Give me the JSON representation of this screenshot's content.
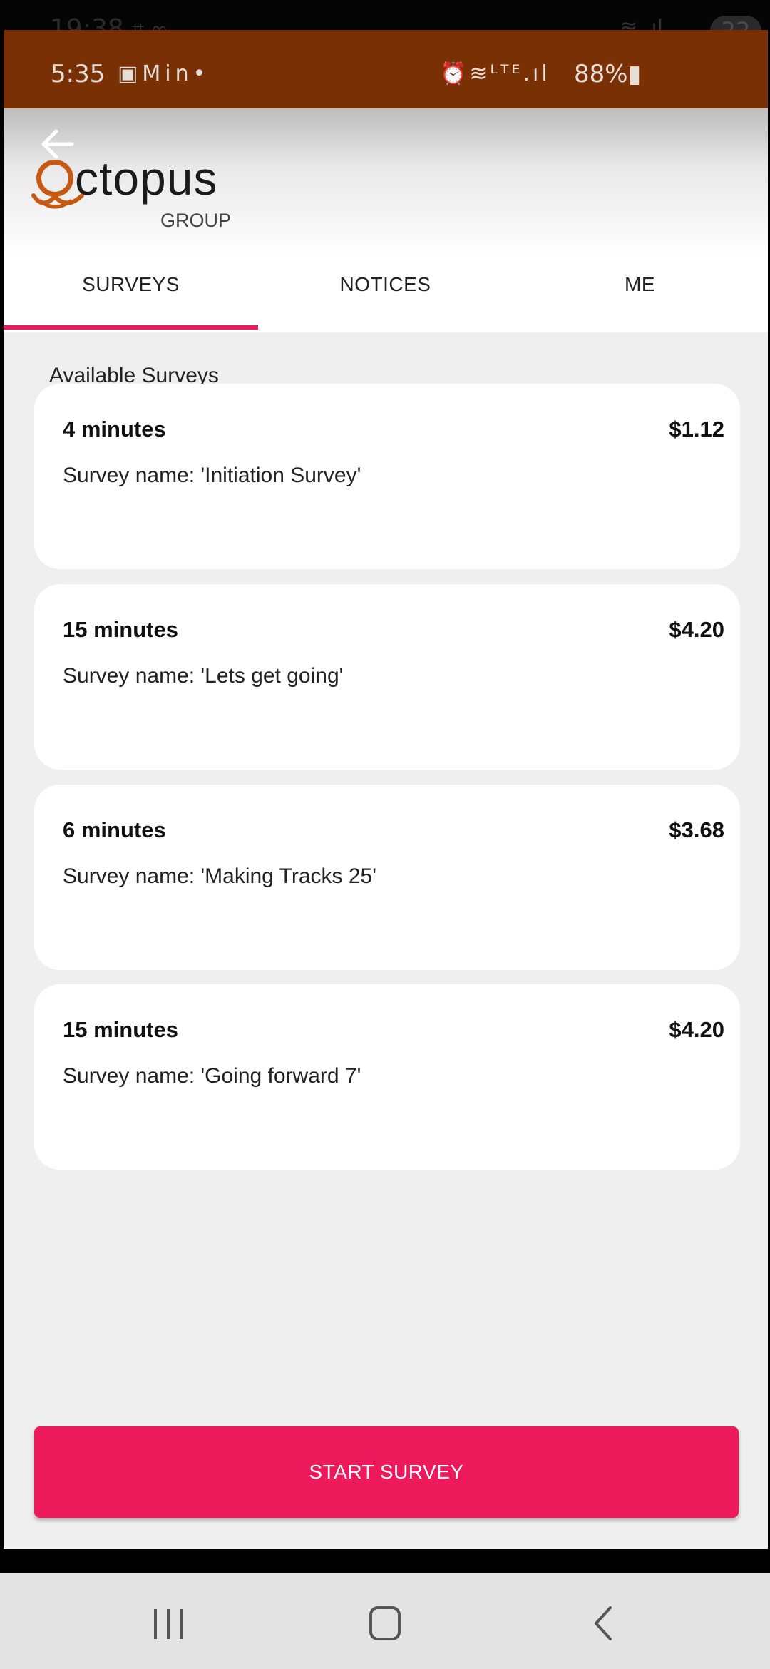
{
  "outer_status": {
    "time": "19:38",
    "badge": "22"
  },
  "status_bar": {
    "time": "5:35",
    "battery": "88%",
    "icons": [
      "image-icon",
      "gmail-icon",
      "linkedin-icon",
      "dot-icon",
      "alarm-icon",
      "wifi-icon",
      "volte-icon",
      "signal-icon",
      "battery-icon"
    ]
  },
  "header": {
    "logo_word": "ctopus",
    "logo_sub": "GROUP"
  },
  "tabs": [
    {
      "label": "SURVEYS",
      "active": true
    },
    {
      "label": "NOTICES",
      "active": false
    },
    {
      "label": "ME",
      "active": false
    }
  ],
  "section_title": "Available Surveys",
  "surveys": [
    {
      "duration": "4 minutes",
      "price": "$1.12",
      "name": "Survey name: 'Initiation Survey'"
    },
    {
      "duration": "15 minutes",
      "price": "$4.20",
      "name": "Survey name: 'Lets get going'"
    },
    {
      "duration": "6 minutes",
      "price": "$3.68",
      "name": "Survey name: 'Making Tracks 25'"
    },
    {
      "duration": "15 minutes",
      "price": "$4.20",
      "name": "Survey name: 'Going forward 7'"
    }
  ],
  "start_button": "START SURVEY",
  "colors": {
    "accent": "#ec1a5b",
    "status_bar": "#7a3005",
    "logo": "#c65a12",
    "background": "#efeff0"
  }
}
